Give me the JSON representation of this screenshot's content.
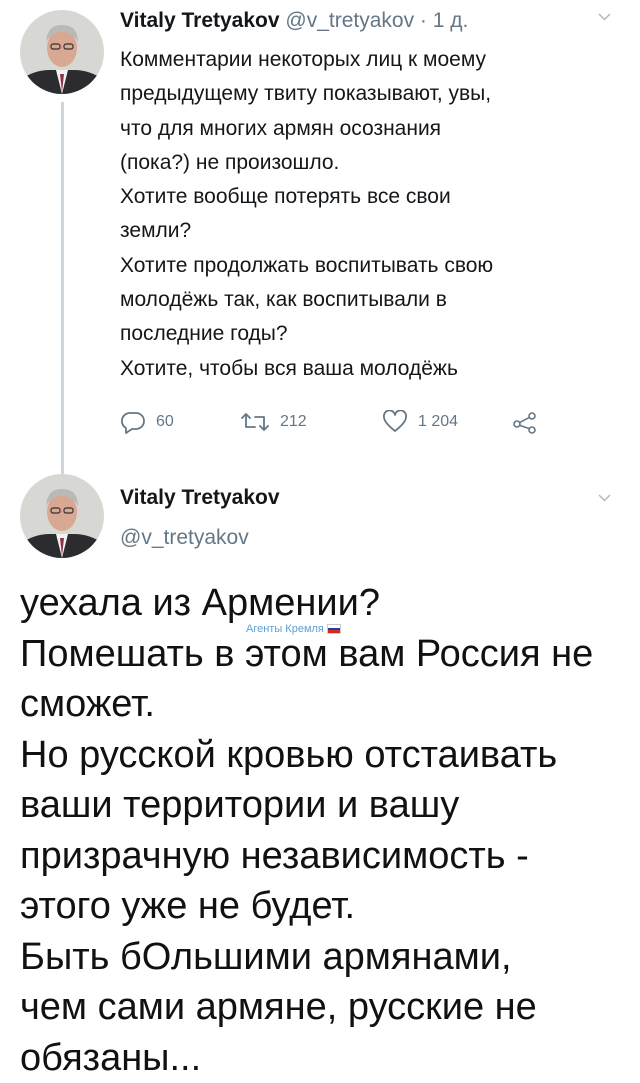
{
  "tweet1": {
    "author_name": "Vitaly Tretyakov",
    "handle": "@v_tretyakov",
    "separator": " · ",
    "time": "1 д.",
    "lines": [
      "Комментарии некоторых лиц к моему",
      "предыдущему твиту показывают, увы,",
      "что для многих армян осознания",
      "(пока?) не произошло.",
      "Хотите вообще потерять все свои",
      "земли?",
      "Хотите продолжать воспитывать свою",
      "молодёжь так, как воспитывали в",
      "последние годы?",
      "Хотите, чтобы вся ваша молодёжь"
    ],
    "actions": {
      "replies": "60",
      "retweets": "212",
      "likes": "1 204"
    }
  },
  "tweet2": {
    "author_name": "Vitaly Tretyakov",
    "handle": "@v_tretyakov",
    "lines": [
      "уехала из Армении?",
      "Помешать в этом вам Россия не",
      "сможет.",
      "Но русской кровью отстаивать",
      "ваши территории и вашу",
      "призрачную независимость -",
      "этого уже не будет.",
      "Быть бОльшими армянами,",
      "чем сами армяне, русские не",
      "обязаны..."
    ]
  },
  "watermark": {
    "text": "Агенты Кремля"
  },
  "icons": {
    "reply": "reply-icon",
    "retweet": "retweet-icon",
    "like": "heart-icon",
    "share": "share-icon",
    "menu": "chevron-down-icon",
    "flag": "russian-flag-icon"
  },
  "colors": {
    "text": "#14171a",
    "secondary": "#657786",
    "thread_line": "#ccd6dd",
    "watermark": "#5a9fd4"
  }
}
